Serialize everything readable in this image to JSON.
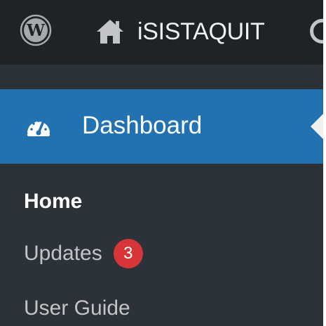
{
  "admin_bar": {
    "logo_icon": "wordpress-logo-icon",
    "home_icon": "home-icon",
    "site_name": "iSISTAQUIT",
    "updates_icon": "refresh-icon",
    "background": "#1d2327"
  },
  "sidebar": {
    "background": "#2c3338",
    "active_item": {
      "icon": "dashboard-gauge-icon",
      "label": "Dashboard",
      "background": "#2271b1"
    },
    "submenu": [
      {
        "label": "Home",
        "current": true
      },
      {
        "label": "Updates",
        "badge": "3"
      },
      {
        "label": "User Guide"
      }
    ],
    "badge_color": "#d63638"
  }
}
